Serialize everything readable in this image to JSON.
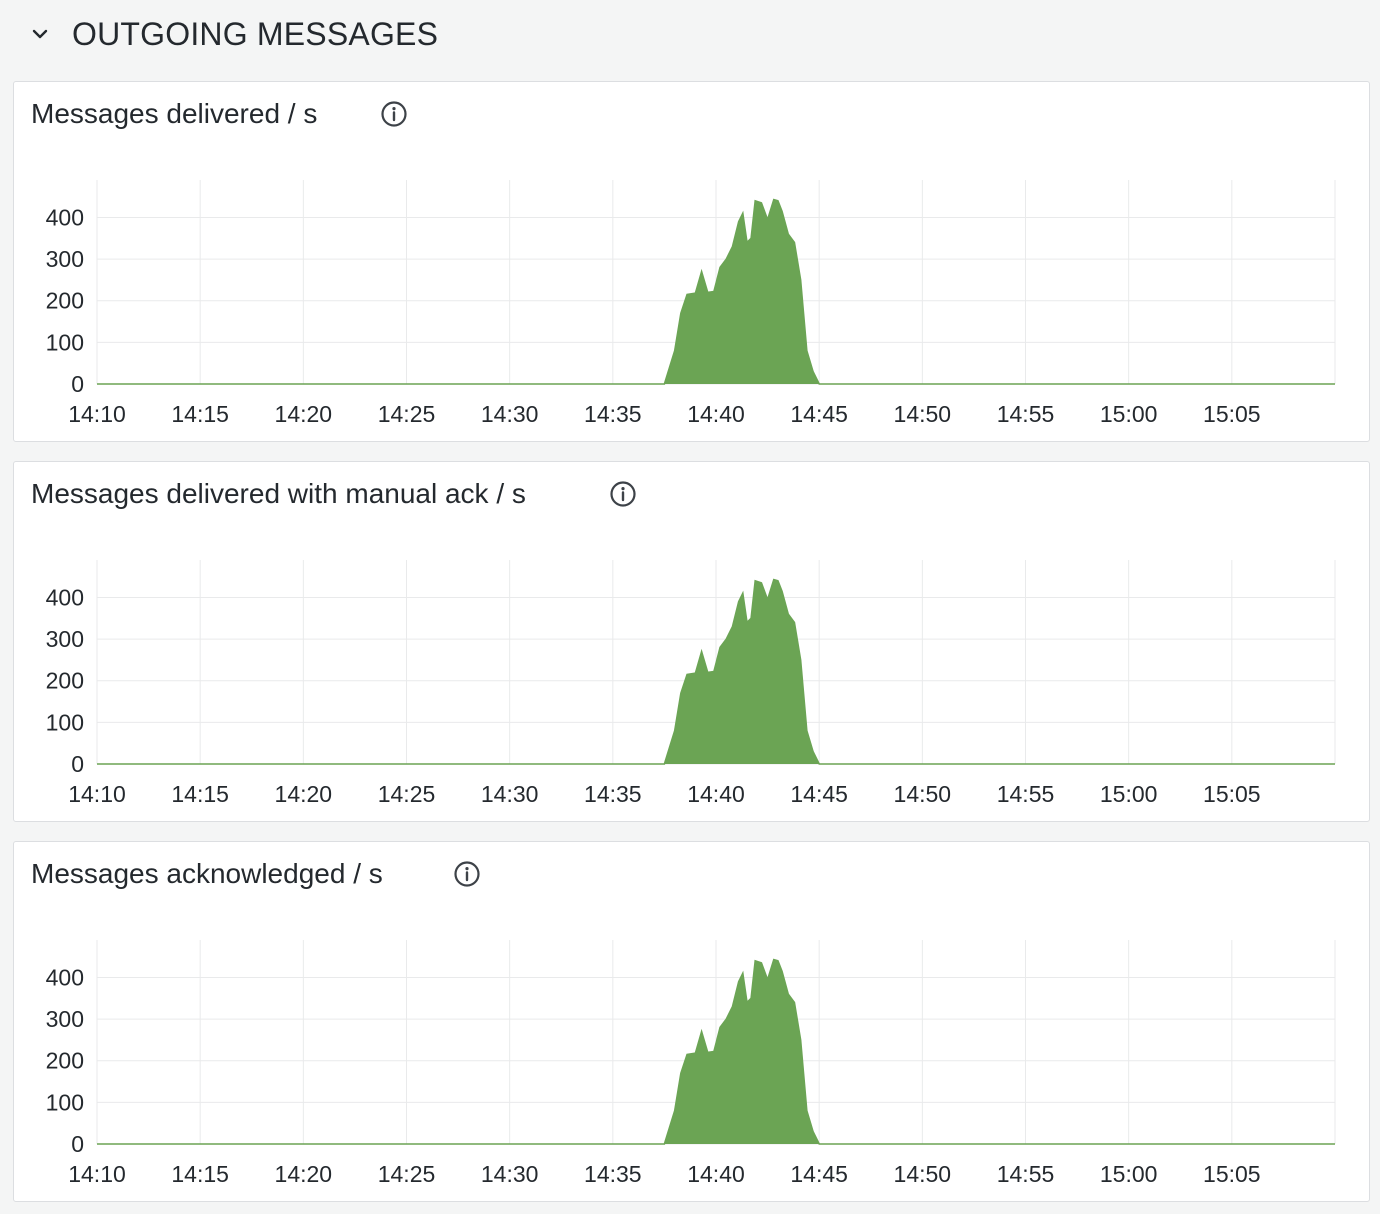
{
  "row": {
    "title": "OUTGOING MESSAGES"
  },
  "icons": {
    "collapse": "chevron-down-icon",
    "info": "info-circle-icon"
  },
  "colors": {
    "series": "#6ba454",
    "grid": "#e9eaeb",
    "axis_line": "#6ba454"
  },
  "panels": [
    {
      "title": "Messages delivered / s"
    },
    {
      "title": "Messages delivered with manual ack / s"
    },
    {
      "title": "Messages acknowledged / s"
    }
  ],
  "chart_data": [
    {
      "type": "area",
      "title": "Messages delivered / s",
      "x_ticks": [
        "14:10",
        "14:15",
        "14:20",
        "14:25",
        "14:30",
        "14:35",
        "14:40",
        "14:45",
        "14:50",
        "14:55",
        "15:00",
        "15:05"
      ],
      "y_ticks": [
        "0",
        "100",
        "200",
        "300",
        "400"
      ],
      "ylim": [
        0,
        490
      ],
      "xlim": [
        "14:10",
        "15:10"
      ],
      "grid": true,
      "x": [
        "14:10",
        "14:37.5",
        "14:38",
        "14:38.3",
        "14:38.6",
        "14:39",
        "14:39.3",
        "14:39.6",
        "14:39.9",
        "14:40.2",
        "14:40.5",
        "14:40.8",
        "14:41.1",
        "14:41.3",
        "14:41.5",
        "14:41.7",
        "14:41.9",
        "14:42.2",
        "14:42.5",
        "14:42.8",
        "14:43.0",
        "14:43.2",
        "14:43.5",
        "14:43.8",
        "14:44.1",
        "14:44.4",
        "14:44.7",
        "14:45",
        "15:10"
      ],
      "series": [
        {
          "values": [
            0,
            0,
            80,
            170,
            215,
            218,
            270,
            220,
            222,
            280,
            300,
            330,
            390,
            410,
            340,
            350,
            440,
            435,
            395,
            443,
            440,
            415,
            360,
            340,
            250,
            80,
            30,
            0,
            0
          ]
        }
      ]
    },
    {
      "type": "area",
      "title": "Messages delivered with manual ack / s",
      "x_ticks": [
        "14:10",
        "14:15",
        "14:20",
        "14:25",
        "14:30",
        "14:35",
        "14:40",
        "14:45",
        "14:50",
        "14:55",
        "15:00",
        "15:05"
      ],
      "y_ticks": [
        "0",
        "100",
        "200",
        "300",
        "400"
      ],
      "ylim": [
        0,
        490
      ],
      "xlim": [
        "14:10",
        "15:10"
      ],
      "grid": true,
      "x": [
        "14:10",
        "14:37.5",
        "14:38",
        "14:38.3",
        "14:38.6",
        "14:39",
        "14:39.3",
        "14:39.6",
        "14:39.9",
        "14:40.2",
        "14:40.5",
        "14:40.8",
        "14:41.1",
        "14:41.3",
        "14:41.5",
        "14:41.7",
        "14:41.9",
        "14:42.2",
        "14:42.5",
        "14:42.8",
        "14:43.0",
        "14:43.2",
        "14:43.5",
        "14:43.8",
        "14:44.1",
        "14:44.4",
        "14:44.7",
        "14:45",
        "15:10"
      ],
      "series": [
        {
          "values": [
            0,
            0,
            80,
            170,
            215,
            218,
            270,
            220,
            222,
            280,
            300,
            330,
            390,
            410,
            340,
            350,
            440,
            435,
            395,
            443,
            440,
            415,
            360,
            340,
            250,
            80,
            30,
            0,
            0
          ]
        }
      ]
    },
    {
      "type": "area",
      "title": "Messages acknowledged / s",
      "x_ticks": [
        "14:10",
        "14:15",
        "14:20",
        "14:25",
        "14:30",
        "14:35",
        "14:40",
        "14:45",
        "14:50",
        "14:55",
        "15:00",
        "15:05"
      ],
      "y_ticks": [
        "0",
        "100",
        "200",
        "300",
        "400"
      ],
      "ylim": [
        0,
        490
      ],
      "xlim": [
        "14:10",
        "15:10"
      ],
      "grid": true,
      "x": [
        "14:10",
        "14:37.5",
        "14:38",
        "14:38.3",
        "14:38.6",
        "14:39",
        "14:39.3",
        "14:39.6",
        "14:39.9",
        "14:40.2",
        "14:40.5",
        "14:40.8",
        "14:41.1",
        "14:41.3",
        "14:41.5",
        "14:41.7",
        "14:41.9",
        "14:42.2",
        "14:42.5",
        "14:42.8",
        "14:43.0",
        "14:43.2",
        "14:43.5",
        "14:43.8",
        "14:44.1",
        "14:44.4",
        "14:44.7",
        "14:45",
        "15:10"
      ],
      "series": [
        {
          "values": [
            0,
            0,
            80,
            170,
            215,
            218,
            270,
            220,
            222,
            280,
            300,
            330,
            390,
            410,
            340,
            350,
            440,
            435,
            395,
            443,
            440,
            415,
            360,
            340,
            250,
            80,
            30,
            0,
            0
          ]
        }
      ]
    }
  ]
}
